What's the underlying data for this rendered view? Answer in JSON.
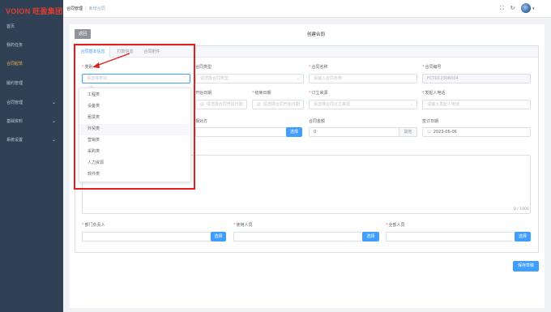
{
  "app": {
    "logo": "VOION 旺盈集团"
  },
  "sidebar": {
    "items": [
      {
        "label": "首页",
        "active": false,
        "expandable": false
      },
      {
        "label": "我的任务",
        "active": false,
        "expandable": false
      },
      {
        "label": "合同起草",
        "active": true,
        "expandable": false
      },
      {
        "label": "履约管理",
        "active": false,
        "expandable": false
      },
      {
        "label": "合同管理",
        "active": false,
        "expandable": true
      },
      {
        "label": "基础资料",
        "active": false,
        "expandable": true
      },
      {
        "label": "系统设置",
        "active": false,
        "expandable": true
      }
    ]
  },
  "header": {
    "breadcrumb": [
      "合同管理",
      "新增合同"
    ],
    "icons": [
      "fullscreen-icon",
      "refresh-icon",
      "user-avatar-icon"
    ]
  },
  "page": {
    "back_label": "返回",
    "title": "创建合同",
    "save_label": "保存草稿"
  },
  "tabs": [
    "合同基本信息",
    "打款信息",
    "合同附件"
  ],
  "form": {
    "category": {
      "label": "类别",
      "placeholder": "请选择类别"
    },
    "contract_type": {
      "label": "合同类型",
      "placeholder": "请选择合同类型"
    },
    "contract_name": {
      "label": "合同名称",
      "placeholder": "请输入合同名称"
    },
    "contract_no": {
      "label": "合同编号",
      "value": "FCTD12306004"
    },
    "start_date": {
      "label": "开始日期",
      "placeholder": "请选择合同开始日期"
    },
    "end_date": {
      "label": "结束日期",
      "placeholder": "请选择合同开始日期"
    },
    "order_source": {
      "label": "订立来源",
      "placeholder": "请选择合同订立来源"
    },
    "initiator_phone": {
      "label": "发起人电话",
      "placeholder": "请输入发起人电话"
    },
    "counterparty": {
      "label": "相对方",
      "button": "选择"
    },
    "amount": {
      "label": "合同金额",
      "value": "0",
      "append": "其他"
    },
    "sign_date": {
      "label": "签订日期",
      "value": "2023-06-06"
    },
    "textarea_counter": "0 / 1000",
    "dept_head": {
      "label": "部门负责人",
      "button": "选择"
    },
    "user": {
      "label": "使用人员",
      "button": "选择"
    },
    "all_staff": {
      "label": "全部人员",
      "button": "选择"
    }
  },
  "dropdown": {
    "options": [
      "工程类",
      "设备类",
      "租赁类",
      "外贸类",
      "营销类",
      "采购类",
      "人力资源",
      "软件类"
    ],
    "hovered_index": 3
  },
  "colors": {
    "primary": "#409eff",
    "sidebar": "#304156",
    "annotation": "#e02020",
    "active_menu": "#f0ad4e"
  }
}
